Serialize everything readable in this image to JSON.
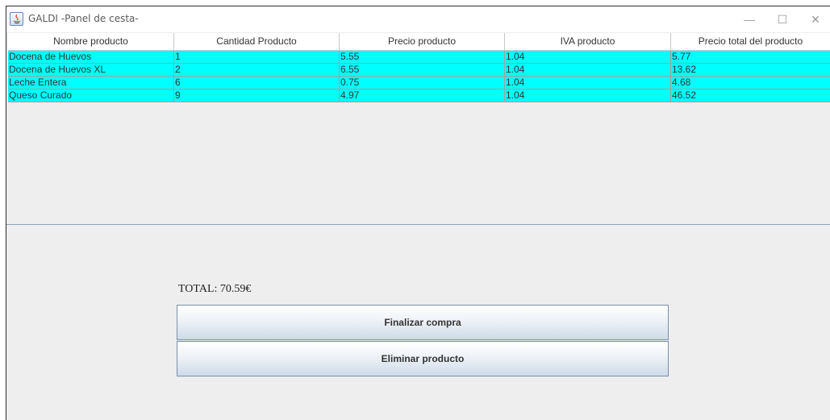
{
  "window": {
    "title": "GALDI -Panel de cesta-",
    "controls": {
      "minimize": "—",
      "maximize": "☐",
      "close": "✕"
    }
  },
  "table": {
    "headers": [
      "Nombre producto",
      "Cantidad Producto",
      "Precio producto",
      "IVA producto",
      "Precio total del producto"
    ],
    "rows": [
      [
        "Docena de Huevos",
        "1",
        "5.55",
        "1.04",
        "5.77"
      ],
      [
        "Docena de Huevos XL",
        "2",
        "6.55",
        "1.04",
        "13.62"
      ],
      [
        "Leche Entera",
        "6",
        "0.75",
        "1.04",
        "4.68"
      ],
      [
        "Queso Curado",
        "9",
        "4.97",
        "1.04",
        "46.52"
      ]
    ],
    "row_color": "#00ffff"
  },
  "summary": {
    "total_label": "TOTAL: 70.59€"
  },
  "actions": {
    "finalize_label": "Finalizar compra",
    "remove_label": "Eliminar producto"
  }
}
